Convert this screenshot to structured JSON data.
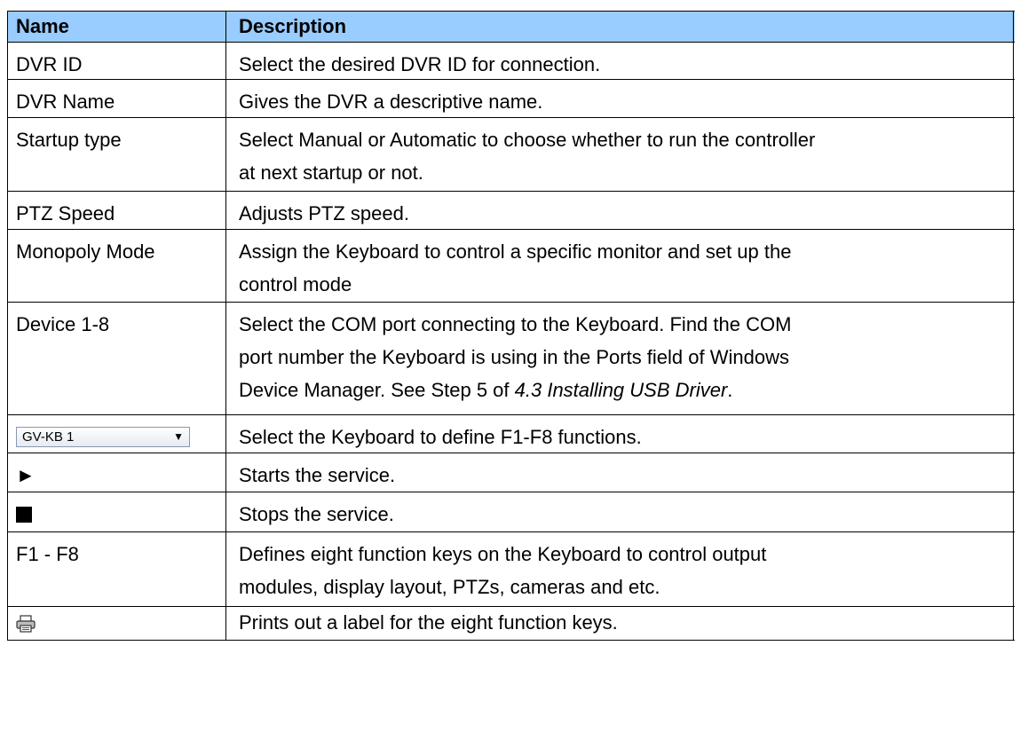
{
  "header": {
    "name": "Name",
    "description": "Description"
  },
  "rows": [
    {
      "name": "DVR ID",
      "desc": "Select the desired DVR ID for connection."
    },
    {
      "name": "DVR Name",
      "desc": "Gives the DVR a descriptive name."
    },
    {
      "name": "Startup type",
      "desc_line1": "Select Manual or Automatic to choose whether to run the controller",
      "desc_line2": "at next startup or not."
    },
    {
      "name": "PTZ Speed",
      "desc": "Adjusts PTZ speed."
    },
    {
      "name": "Monopoly Mode",
      "desc_line1": "Assign the Keyboard to control a specific monitor and set up the",
      "desc_line2": "control mode"
    },
    {
      "name": "Device 1-8",
      "desc_line1": "Select the COM port connecting to the Keyboard. Find the COM",
      "desc_line2": "port number the Keyboard is using in the Ports field of Windows",
      "desc_line3_pre": "Device Manager. See Step 5 of ",
      "desc_line3_italic": "4.3 Installing USB Driver",
      "desc_line3_post": "."
    },
    {
      "dropdown_value": "GV-KB 1",
      "desc": "Select the Keyboard to define F1-F8 functions."
    },
    {
      "icon": "play-icon",
      "desc": "Starts the service."
    },
    {
      "icon": "stop-icon",
      "desc": "Stops the service."
    },
    {
      "name": "F1 - F8",
      "desc_line1": "Defines eight function keys on the Keyboard to control output",
      "desc_line2": "modules, display layout, PTZs, cameras and etc."
    },
    {
      "icon": "printer-icon",
      "desc": "Prints out a label for the eight function keys."
    }
  ],
  "colors": {
    "header_bg": "#99ccff"
  }
}
